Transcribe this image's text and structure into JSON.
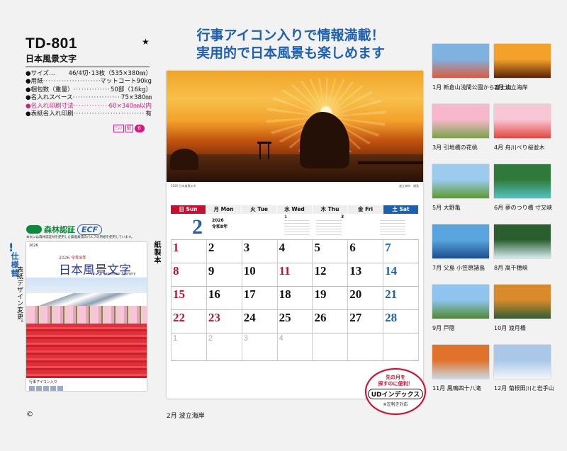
{
  "product": {
    "code": "TD-801",
    "star": "★",
    "name": "日本風景文字",
    "specs": [
      {
        "k": "●サイズ…",
        "v": "46/4切･13枚（535×380㎜）",
        "pink": false,
        "dots": false
      },
      {
        "k": "●用紙",
        "v": "マットコート90kg",
        "pink": false,
        "dots": true
      },
      {
        "k": "●梱包数（重量）",
        "v": "50部（16kg）",
        "pink": false,
        "dots": true
      },
      {
        "k": "●名入れスペース",
        "v": "75×380㎜",
        "pink": false,
        "dots": true
      },
      {
        "k": "●名入れ印刷寸法",
        "v": "60×340㎜以内",
        "pink": true,
        "dots": true
      },
      {
        "k": "●表紙名入れ印刷",
        "v": "有",
        "pink": false,
        "dots": true
      }
    ],
    "badges": [
      "ﾐｼﾝ",
      "紙",
      "6"
    ],
    "cert_main": "森林認証",
    "cert_sub": "ECF",
    "cert_note": "本文には森林認証材を使用した無塩素漂白パルプの用紙を使用しています。",
    "cover": {
      "header": "2026",
      "year": "2026 令和8年",
      "title": "日本風景文字",
      "subtitle": "Japanese Scenery",
      "footer": "行事アイコン入り"
    },
    "copyright": "©"
  },
  "side_labels": {
    "exclaim": "!",
    "spec_change": "仕様替",
    "design_change": "表紙デザイン変更。",
    "binding": "紙製本"
  },
  "headline": [
    "行事アイコン入りで情報満載！",
    "実用的で日本風景も楽しめます"
  ],
  "calendar": {
    "photo_caption_left": "2026 日本風景文字",
    "photo_caption_right": "波立海岸　福島",
    "days_of_week": [
      {
        "jp": "日",
        "en": "Sun"
      },
      {
        "jp": "月",
        "en": "Mon"
      },
      {
        "jp": "火",
        "en": "Tue"
      },
      {
        "jp": "水",
        "en": "Wed"
      },
      {
        "jp": "木",
        "en": "Thu"
      },
      {
        "jp": "金",
        "en": "Fri"
      },
      {
        "jp": "土",
        "en": "Sat"
      }
    ],
    "month": "2",
    "year_label": "2026",
    "era_label": "令和8年",
    "mini_prev": "1",
    "mini_next": "3",
    "weeks": [
      [
        "1",
        "2",
        "3",
        "4",
        "5",
        "6",
        "7"
      ],
      [
        "8",
        "9",
        "10",
        "11",
        "12",
        "13",
        "14"
      ],
      [
        "15",
        "16",
        "17",
        "18",
        "19",
        "20",
        "21"
      ],
      [
        "22",
        "23",
        "24",
        "25",
        "26",
        "27",
        "28"
      ]
    ],
    "next_month_days": [
      "1",
      "2",
      "3",
      "4"
    ],
    "caption": "2月  波立海岸"
  },
  "ud_badge": {
    "line1": "先の月を",
    "line2": "探すのに便利！",
    "main": "UDインデックス",
    "note": "※左利き対応"
  },
  "thumbnails": [
    {
      "label": "1月  新倉山浅間公園から富士山",
      "colors": [
        "#7fb2e0",
        "#e05a3c"
      ]
    },
    {
      "label": "2月  波立海岸",
      "colors": [
        "#f4a12a",
        "#5b2408"
      ]
    },
    {
      "label": "3月  引地橋の花桃",
      "colors": [
        "#f7b7cc",
        "#7aa44a"
      ]
    },
    {
      "label": "4月  舟川べり桜並木",
      "colors": [
        "#f8c7d5",
        "#e2483e"
      ]
    },
    {
      "label": "5月  大野亀",
      "colors": [
        "#9ccbee",
        "#5d9a2f"
      ]
    },
    {
      "label": "6月  夢のつり橋 寸又峡",
      "colors": [
        "#2f7a3a",
        "#53c3c2"
      ]
    },
    {
      "label": "7月  父島 小笠原諸島",
      "colors": [
        "#5aa5e0",
        "#1b4f8a"
      ]
    },
    {
      "label": "8月  高千穂峡",
      "colors": [
        "#2a5e2e",
        "#d8ecef"
      ]
    },
    {
      "label": "9月  戸隠",
      "colors": [
        "#8ec4ee",
        "#4f8a2e"
      ]
    },
    {
      "label": "10月  渡月橋",
      "colors": [
        "#d98a2a",
        "#2e5f35"
      ]
    },
    {
      "label": "11月  鳳鳴四十八滝",
      "colors": [
        "#e0722a",
        "#c9d9e3"
      ]
    },
    {
      "label": "12月  菊根田川と岩手山",
      "colors": [
        "#a9c8e8",
        "#f3f6f8"
      ]
    }
  ]
}
